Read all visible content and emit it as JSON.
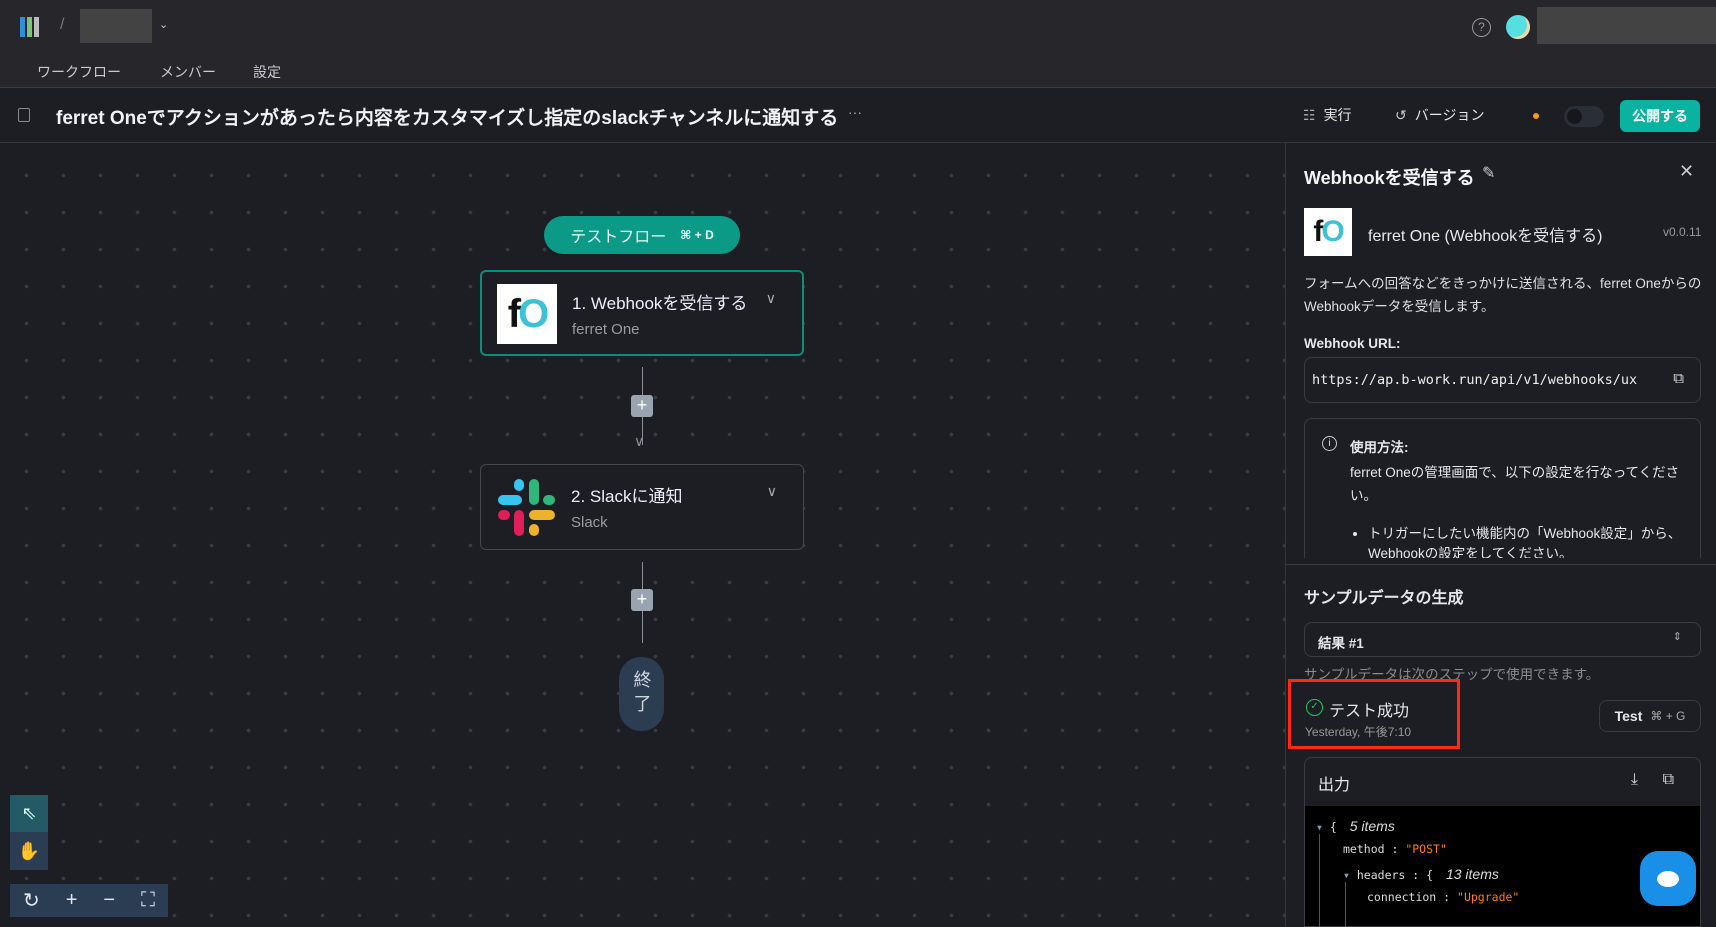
{
  "topbar": {
    "separator": "/",
    "nav": [
      "ワークフロー",
      "メンバー",
      "設定"
    ]
  },
  "header": {
    "title": "ferret Oneでアクションがあったら内容をカスタマイズし指定のslackチャンネルに通知する",
    "more": "···",
    "run_label": "実行",
    "version_label": "バージョン",
    "publish_label": "公開する"
  },
  "canvas": {
    "test_flow": {
      "label": "テストフロー",
      "shortcut": "⌘ + D"
    },
    "nodes": [
      {
        "title": "1. Webhookを受信する",
        "subtitle": "ferret One",
        "logo": "fO"
      },
      {
        "title": "2. Slackに通知",
        "subtitle": "Slack"
      }
    ],
    "end_label": "終了"
  },
  "panel": {
    "title": "Webhookを受信する",
    "app_name": "ferret One (Webhookを受信する)",
    "version": "v0.0.11",
    "description": "フォームへの回答などをきっかけに送信される、ferret OneからのWebhookデータを受信します。",
    "url_label": "Webhook URL:",
    "url": "https://ap.b-work.run/api/v1/webhooks/ux",
    "usage_title": "使用方法:",
    "usage_text": "ferret Oneの管理画面で、以下の設定を行なってください。",
    "usage_bullet": "トリガーにしたい機能内の「Webhook設定」から、Webhookの設定をしてください。",
    "sample_title": "サンプルデータの生成",
    "result_select": "結果 #1",
    "sample_note": "サンプルデータは次のステップで使用できます。",
    "test_status": "テスト成功",
    "test_time": "Yesterday, 午後7:10",
    "test_button": "Test",
    "test_shortcut": "⌘ + G",
    "output_label": "出力",
    "json": {
      "root_count": "5 items",
      "method_key": "method",
      "method_val": "\"POST\"",
      "headers_key": "headers",
      "headers_count": "13 items",
      "conn_key": "connection",
      "conn_val": "\"Upgrade\""
    }
  },
  "colors": {
    "accent": "#0ab3a0",
    "success": "#22c55e",
    "highlight": "#ff2a10",
    "string": "#ff7a1a"
  }
}
